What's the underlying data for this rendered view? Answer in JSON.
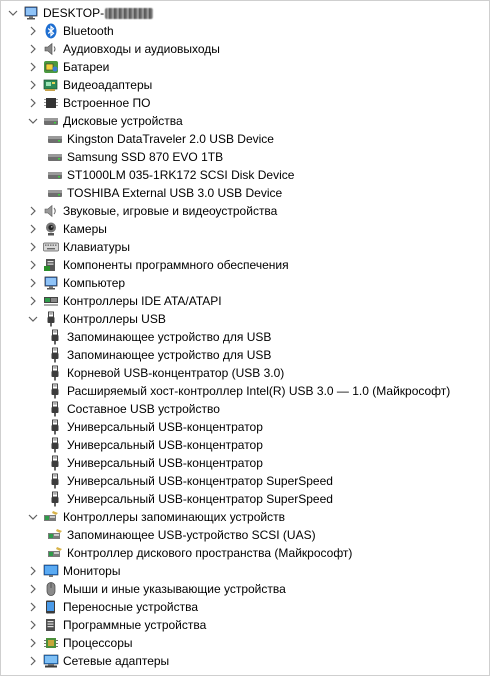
{
  "tree": {
    "root": {
      "label": "DESKTOP-",
      "expanded": true
    },
    "categories": [
      {
        "label": "Bluetooth",
        "icon": "bluetooth-icon",
        "expanded": false
      },
      {
        "label": "Аудиовходы и аудиовыходы",
        "icon": "speaker-icon",
        "expanded": false
      },
      {
        "label": "Батареи",
        "icon": "battery-icon",
        "expanded": false
      },
      {
        "label": "Видеоадаптеры",
        "icon": "display-adapter-icon",
        "expanded": false
      },
      {
        "label": "Встроенное ПО",
        "icon": "firmware-icon",
        "expanded": false
      },
      {
        "label": "Дисковые устройства",
        "icon": "disk-drive-icon",
        "expanded": true,
        "children": [
          {
            "label": "Kingston DataTraveler 2.0 USB Device",
            "icon": "disk-drive-icon"
          },
          {
            "label": "Samsung SSD 870 EVO 1TB",
            "icon": "disk-drive-icon"
          },
          {
            "label": "ST1000LM 035-1RK172 SCSI Disk Device",
            "icon": "disk-drive-icon"
          },
          {
            "label": "TOSHIBA External USB 3.0 USB Device",
            "icon": "disk-drive-icon"
          }
        ]
      },
      {
        "label": "Звуковые, игровые и видеоустройства",
        "icon": "sound-icon",
        "expanded": false
      },
      {
        "label": "Камеры",
        "icon": "camera-icon",
        "expanded": false
      },
      {
        "label": "Клавиатуры",
        "icon": "keyboard-icon",
        "expanded": false
      },
      {
        "label": "Компоненты программного обеспечения",
        "icon": "software-component-icon",
        "expanded": false
      },
      {
        "label": "Компьютер",
        "icon": "computer-icon",
        "expanded": false
      },
      {
        "label": "Контроллеры IDE ATA/ATAPI",
        "icon": "ide-controller-icon",
        "expanded": false
      },
      {
        "label": "Контроллеры USB",
        "icon": "usb-icon",
        "expanded": true,
        "children": [
          {
            "label": "Запоминающее устройство для USB",
            "icon": "usb-icon"
          },
          {
            "label": "Запоминающее устройство для USB",
            "icon": "usb-icon"
          },
          {
            "label": "Корневой USB-концентратор (USB 3.0)",
            "icon": "usb-icon"
          },
          {
            "label": "Расширяемый хост-контроллер Intel(R) USB 3.0 — 1.0 (Майкрософт)",
            "icon": "usb-icon"
          },
          {
            "label": "Составное USB устройство",
            "icon": "usb-icon"
          },
          {
            "label": "Универсальный USB-концентратор",
            "icon": "usb-icon"
          },
          {
            "label": "Универсальный USB-концентратор",
            "icon": "usb-icon"
          },
          {
            "label": "Универсальный USB-концентратор",
            "icon": "usb-icon"
          },
          {
            "label": "Универсальный USB-концентратор SuperSpeed",
            "icon": "usb-icon"
          },
          {
            "label": "Универсальный USB-концентратор SuperSpeed",
            "icon": "usb-icon"
          }
        ]
      },
      {
        "label": "Контроллеры запоминающих устройств",
        "icon": "storage-controller-icon",
        "expanded": true,
        "children": [
          {
            "label": "Запоминающее USB-устройство SCSI (UAS)",
            "icon": "storage-controller-icon"
          },
          {
            "label": "Контроллер дискового пространства (Майкрософт)",
            "icon": "storage-controller-icon"
          }
        ]
      },
      {
        "label": "Мониторы",
        "icon": "monitor-icon",
        "expanded": false
      },
      {
        "label": "Мыши и иные указывающие устройства",
        "icon": "mouse-icon",
        "expanded": false
      },
      {
        "label": "Переносные устройства",
        "icon": "portable-device-icon",
        "expanded": false
      },
      {
        "label": "Программные устройства",
        "icon": "software-device-icon",
        "expanded": false
      },
      {
        "label": "Процессоры",
        "icon": "processor-icon",
        "expanded": false
      },
      {
        "label": "Сетевые адаптеры",
        "icon": "network-adapter-icon",
        "expanded": false
      }
    ]
  }
}
